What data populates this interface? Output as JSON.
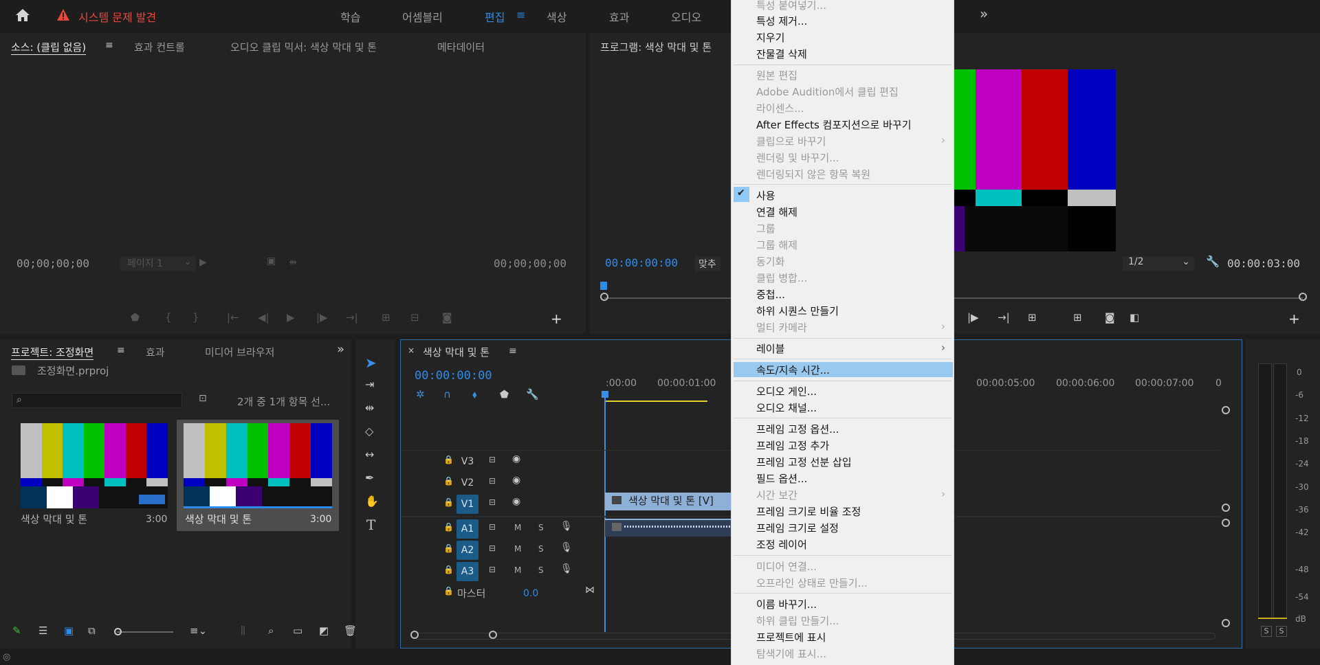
{
  "topbar": {
    "home_icon": "home-icon",
    "warning_text": "시스템 문제 발견",
    "workspaces": [
      "학습",
      "어셈블리",
      "편집",
      "색상",
      "효과",
      "오디오"
    ],
    "active_workspace": "편집",
    "more_glyph": "»"
  },
  "source_panel": {
    "tabs": [
      "소스: (클립 없음)",
      "효과 컨트롤",
      "오디오 클립 믹서: 색상 막대 및 톤",
      "메타데이터"
    ],
    "tc_left": "00;00;00;00",
    "page_select": "페이지 1",
    "tc_right": "00;00;00;00"
  },
  "program_panel": {
    "title": "프로그램: 색상 막대 및 톤",
    "tc_left": "00:00:00:00",
    "fit_select": "맞추",
    "resolution": "1/2",
    "tc_right": "00:00:03:00"
  },
  "project_panel": {
    "tabs": [
      "프로젝트: 조정화면",
      "효과",
      "미디어 브라우저"
    ],
    "file": "조정화면.prproj",
    "item_count": "2개 중 1개 항목 선...",
    "items": [
      {
        "name": "색상 막대 및 톤",
        "duration": "3:00"
      },
      {
        "name": "색상 막대 및 톤",
        "duration": "3:00"
      }
    ]
  },
  "timeline": {
    "tab": "색상 막대 및 톤",
    "timecode": "00:00:00:00",
    "ruler": [
      ":00:00",
      "00:00:01:00",
      "00:00:05:00",
      "00:00:06:00",
      "00:00:07:00",
      "0"
    ],
    "video_tracks": [
      "V3",
      "V2",
      "V1"
    ],
    "audio_tracks": [
      "A1",
      "A2",
      "A3"
    ],
    "master_label": "마스터",
    "master_value": "0.0",
    "clip_label": "색상 막대 및 톤 [V]",
    "m_label": "M",
    "s_label": "S"
  },
  "meter": {
    "labels": [
      "0",
      "-6",
      "-12",
      "-18",
      "-24",
      "-30",
      "-36",
      "-42",
      "-48",
      "-54",
      "dB"
    ],
    "solo": [
      "S",
      "S"
    ]
  },
  "context_menu": {
    "items": [
      {
        "label": "특성 붙여넣기...",
        "disabled": true
      },
      {
        "label": "특성 제거...",
        "disabled": false
      },
      {
        "label": "지우기",
        "disabled": false
      },
      {
        "label": "잔물결 삭제",
        "disabled": false
      },
      {
        "label": "원본 편집",
        "disabled": true
      },
      {
        "label": "Adobe Audition에서 클립 편집",
        "disabled": true
      },
      {
        "label": "라이센스...",
        "disabled": true
      },
      {
        "label": "After Effects 컴포지션으로 바꾸기",
        "disabled": false
      },
      {
        "label": "클립으로 바꾸기",
        "disabled": true
      },
      {
        "label": "렌더링 및 바꾸기...",
        "disabled": true
      },
      {
        "label": "렌더링되지 않은 항목 복원",
        "disabled": true
      },
      {
        "label": "사용",
        "disabled": false
      },
      {
        "label": "연결 해제",
        "disabled": false
      },
      {
        "label": "그룹",
        "disabled": true
      },
      {
        "label": "그룹 해제",
        "disabled": true
      },
      {
        "label": "동기화",
        "disabled": true
      },
      {
        "label": "클립 병합...",
        "disabled": true
      },
      {
        "label": "중첩...",
        "disabled": false
      },
      {
        "label": "하위 시퀀스 만들기",
        "disabled": false
      },
      {
        "label": "멀티 카메라",
        "disabled": true
      },
      {
        "label": "레이블",
        "disabled": false
      },
      {
        "label": "속도/지속 시간...",
        "disabled": false
      },
      {
        "label": "오디오 게인...",
        "disabled": false
      },
      {
        "label": "오디오 채널...",
        "disabled": false
      },
      {
        "label": "프레임 고정 옵션...",
        "disabled": false
      },
      {
        "label": "프레임 고정 추가",
        "disabled": false
      },
      {
        "label": "프레임 고정 선분 삽입",
        "disabled": false
      },
      {
        "label": "필드 옵션...",
        "disabled": false
      },
      {
        "label": "시간 보간",
        "disabled": true
      },
      {
        "label": "프레임 크기로 비율 조정",
        "disabled": false
      },
      {
        "label": "프레임 크기로 설정",
        "disabled": false
      },
      {
        "label": "조정 레이어",
        "disabled": false
      },
      {
        "label": "미디어 연결...",
        "disabled": true
      },
      {
        "label": "오프라인 상태로 만들기...",
        "disabled": true
      },
      {
        "label": "이름 바꾸기...",
        "disabled": false
      },
      {
        "label": "하위 클립 만들기...",
        "disabled": true
      },
      {
        "label": "프로젝트에 표시",
        "disabled": false
      },
      {
        "label": "탐색기에 표시...",
        "disabled": true
      }
    ],
    "checked_item": "사용",
    "highlighted_item": "속도/지속 시간...",
    "colors": {
      "highlight": "#99c9ef",
      "check_bg": "#90c8f6"
    }
  },
  "colors": {
    "accent_blue": "#2d8ceb",
    "warning_red": "#e8473c",
    "playhead_blue": "#3a8ee6",
    "track_on": "#1c5a87"
  }
}
